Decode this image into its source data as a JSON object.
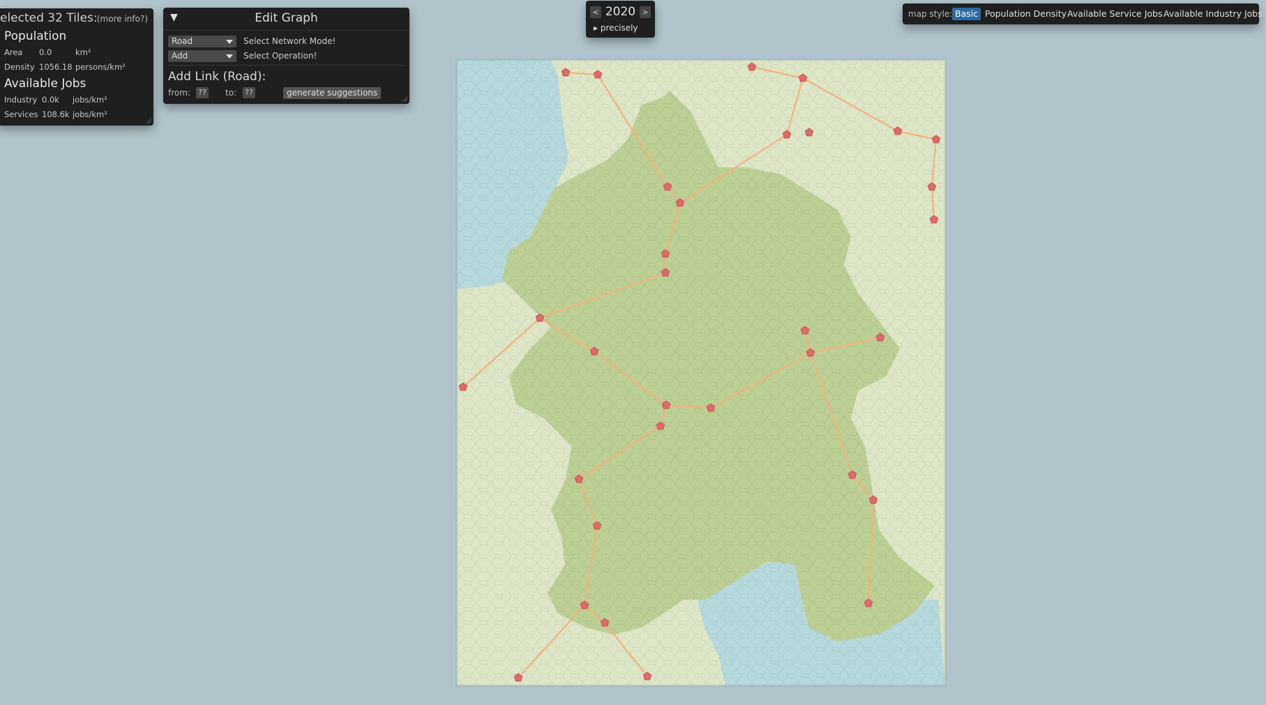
{
  "selection": {
    "title": "elected 32 Tiles:",
    "more_info": "(more info?)",
    "population_heading": "Population",
    "area": {
      "label": "Area",
      "value": "0.0",
      "unit": "km²"
    },
    "density": {
      "label": "Density",
      "value": "1056.18",
      "unit": "persons/km²"
    },
    "jobs_heading": "Available Jobs",
    "industry": {
      "label": "Industry",
      "value": "0.0k",
      "unit": "jobs/km²"
    },
    "services": {
      "label": "Services",
      "value": "108.6k",
      "unit": "jobs/km²"
    }
  },
  "edit_graph": {
    "toggle": "▼",
    "title": "Edit Graph",
    "network_mode": {
      "value": "Road",
      "label": "Select Network Mode!"
    },
    "operation": {
      "value": "Add",
      "label": "Select Operation!"
    },
    "add_link_title": "Add Link (Road):",
    "from_label": "from:",
    "from_value": "??",
    "to_label": "to:",
    "to_value": "??",
    "suggest_button": "generate suggestions"
  },
  "year_control": {
    "prev": "<",
    "year": "2020",
    "next": ">",
    "precisely": "▸ precisely"
  },
  "map_style": {
    "label": "map style:",
    "options": [
      "Basic",
      "Population Density",
      "Available Service Jobs",
      "Available Industry Jobs"
    ],
    "selected": "Basic"
  },
  "map": {
    "colors": {
      "water": "#b6d9de",
      "light_land": "#dde6c6",
      "dark_land": "#bccf94",
      "road": "#f4b27a",
      "node": "#e06a6a",
      "background": "#b1c4cc"
    },
    "nodes": [
      {
        "id": "n1"
      },
      {
        "id": "n2"
      },
      {
        "id": "n3"
      },
      {
        "id": "n4"
      },
      {
        "id": "n5"
      },
      {
        "id": "n6"
      },
      {
        "id": "n7"
      },
      {
        "id": "n8"
      },
      {
        "id": "n9"
      },
      {
        "id": "n10"
      },
      {
        "id": "n11"
      },
      {
        "id": "n12"
      },
      {
        "id": "n13"
      },
      {
        "id": "n14"
      },
      {
        "id": "n15"
      },
      {
        "id": "n16"
      },
      {
        "id": "n17"
      },
      {
        "id": "n18"
      },
      {
        "id": "n19"
      },
      {
        "id": "n20"
      },
      {
        "id": "n21"
      },
      {
        "id": "n22"
      },
      {
        "id": "n23"
      },
      {
        "id": "n24"
      },
      {
        "id": "n25"
      },
      {
        "id": "n26"
      },
      {
        "id": "n27"
      },
      {
        "id": "n28"
      },
      {
        "id": "n29"
      },
      {
        "id": "n30"
      },
      {
        "id": "n31"
      },
      {
        "id": "n32"
      }
    ]
  }
}
